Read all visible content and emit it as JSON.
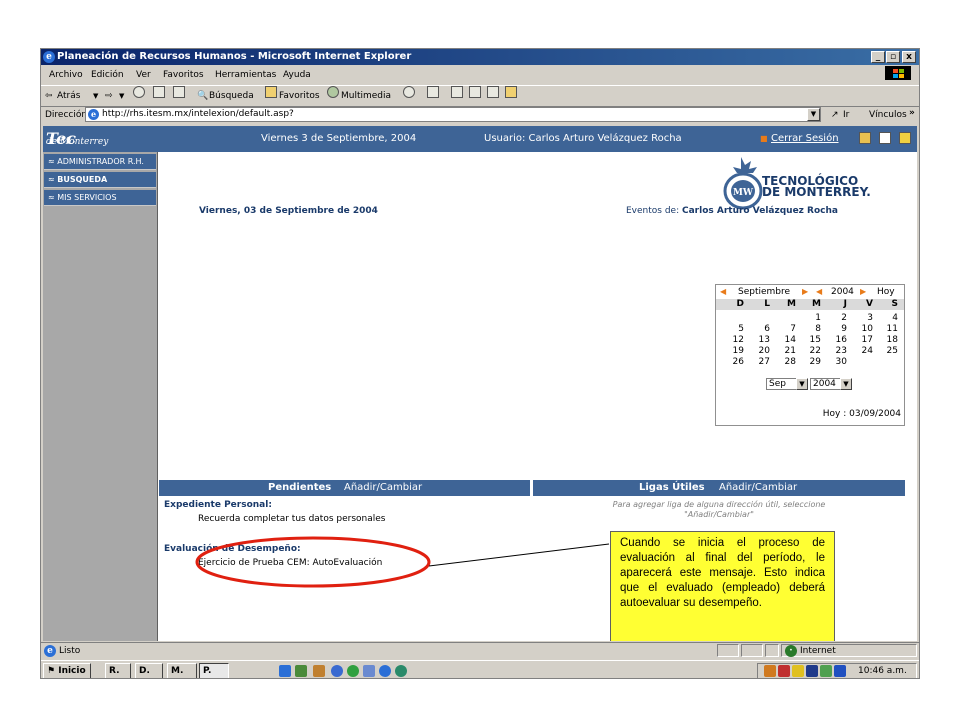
{
  "window": {
    "title": "Planeación de Recursos Humanos - Microsoft Internet Explorer",
    "controls": [
      "_",
      "▫",
      "x"
    ]
  },
  "menu": [
    "Archivo",
    "Edición",
    "Ver",
    "Favoritos",
    "Herramientas",
    "Ayuda"
  ],
  "toolbar": {
    "back": "Atrás",
    "search": "Búsqueda",
    "favorites": "Favoritos",
    "multimedia": "Multimedia"
  },
  "address": {
    "label": "Dirección",
    "url": "http://rhs.itesm.mx/intelexion/default.asp?",
    "go": "Ir",
    "links": "Vínculos"
  },
  "header": {
    "logo_main": "Tec",
    "logo_sub": "de Monterrey",
    "date": "Viernes 3 de Septiembre, 2004",
    "user": "Usuario: Carlos Arturo Velázquez Rocha",
    "logout": "Cerrar Sesión"
  },
  "sidebar": {
    "items": [
      {
        "label": "ADMINISTRADOR R.H."
      },
      {
        "label": "BUSQUEDA"
      },
      {
        "label": "MIS SERVICIOS"
      }
    ]
  },
  "brand": {
    "line1": "TECNOLÓGICO",
    "line2": "DE MONTERREY."
  },
  "main": {
    "date_heading": "Viernes, 03 de Septiembre de 2004",
    "events_label": "Eventos de:",
    "events_user": "Carlos Arturo Velázquez Rocha"
  },
  "calendar": {
    "month": "Septiembre",
    "year": "2004",
    "today_link": "Hoy",
    "weekdays": [
      "D",
      "L",
      "M",
      "M",
      "J",
      "V",
      "S"
    ],
    "weeks": [
      [
        "",
        "",
        "",
        "1",
        "2",
        "3",
        "4"
      ],
      [
        "5",
        "6",
        "7",
        "8",
        "9",
        "10",
        "11"
      ],
      [
        "12",
        "13",
        "14",
        "15",
        "16",
        "17",
        "18"
      ],
      [
        "19",
        "20",
        "21",
        "22",
        "23",
        "24",
        "25"
      ],
      [
        "26",
        "27",
        "28",
        "29",
        "30",
        "",
        ""
      ]
    ],
    "month_select": "Sep",
    "year_select": "2004",
    "today_text": "Hoy : 03/09/2004"
  },
  "pendientes": {
    "title": "Pendientes",
    "action": "Añadir/Cambiar",
    "expediente_title": "Expediente Personal:",
    "expediente_item": "Recuerda completar tus datos personales",
    "evaluacion_title": "Evaluación de Desempeño:",
    "evaluacion_item": "Ejercicio de Prueba CEM: AutoEvaluación"
  },
  "ligas": {
    "title": "Ligas Útiles",
    "action": "Añadir/Cambiar",
    "hint_line1": "Para agregar liga de alguna dirección útil, seleccione",
    "hint_line2": "\"Añadir/Cambiar\""
  },
  "callout": {
    "text": "Cuando se inicia el proceso de evaluación al final del período, le aparecerá este mensaje. Esto indica que el evaluado (empleado) deberá autoevaluar su desempeño."
  },
  "status": {
    "left": "Listo",
    "zone": "Internet"
  },
  "taskbar": {
    "start": "Inicio",
    "buttons": [
      "R.",
      "D.",
      "M.",
      "P."
    ],
    "clock": "10:46 a.m."
  },
  "colors": {
    "navy": "#3e6496",
    "accent": "#e87b1a",
    "callout": "#ffff33",
    "highlight_ring": "#e02010"
  }
}
